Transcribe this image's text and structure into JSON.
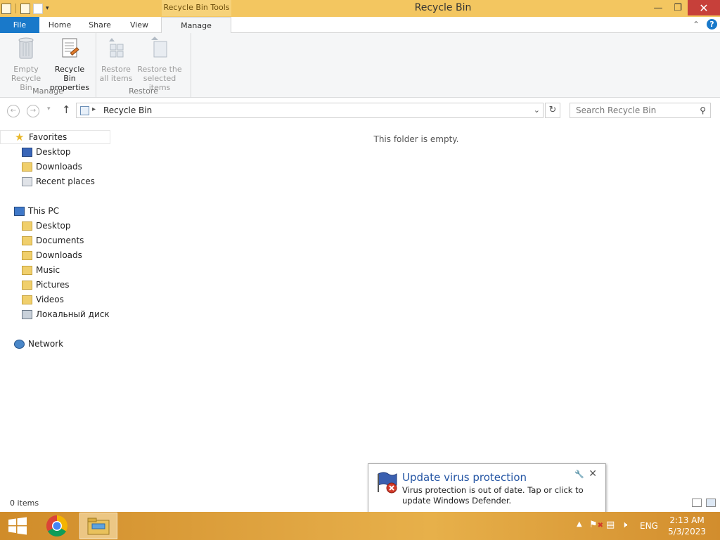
{
  "window": {
    "title": "Recycle Bin",
    "context_tab": "Recycle Bin Tools"
  },
  "tabs": [
    {
      "label": "File"
    },
    {
      "label": "Home"
    },
    {
      "label": "Share"
    },
    {
      "label": "View"
    },
    {
      "label": "Manage"
    }
  ],
  "ribbon": {
    "manage": {
      "label": "Manage",
      "empty_line1": "Empty",
      "empty_line2": "Recycle Bin",
      "props_line1": "Recycle Bin",
      "props_line2": "properties"
    },
    "restore": {
      "label": "Restore",
      "all_line1": "Restore",
      "all_line2": "all items",
      "sel_line1": "Restore the",
      "sel_line2": "selected items"
    }
  },
  "address": {
    "crumb": "Recycle Bin",
    "search_placeholder": "Search Recycle Bin"
  },
  "nav": {
    "favorites": "Favorites",
    "fav_items": [
      "Desktop",
      "Downloads",
      "Recent places"
    ],
    "this_pc": "This PC",
    "pc_items": [
      "Desktop",
      "Documents",
      "Downloads",
      "Music",
      "Pictures",
      "Videos",
      "Локальный диск (C"
    ],
    "network": "Network"
  },
  "content": {
    "empty_message": "This folder is empty."
  },
  "status": {
    "items": "0 items"
  },
  "toast": {
    "title": "Update virus protection",
    "message": "Virus protection is out of date. Tap or click to update Windows Defender."
  },
  "taskbar": {
    "lang": "ENG",
    "time": "2:13 AM",
    "date": "5/3/2023"
  },
  "colors": {
    "titlebar": "#f3c660",
    "file_tab": "#1979ca",
    "close_button": "#c7403a"
  }
}
